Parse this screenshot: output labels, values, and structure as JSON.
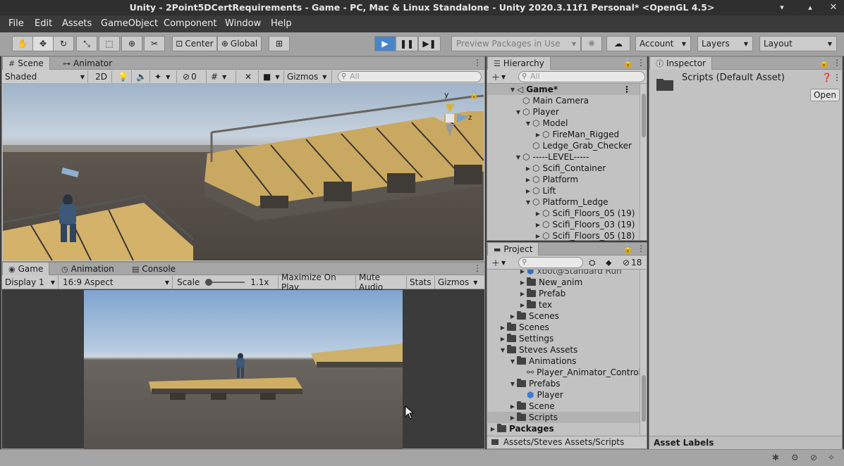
{
  "window": {
    "title": "Unity - 2Point5DCertRequirements - Game - PC, Mac & Linux Standalone - Unity 2020.3.11f1 Personal* <OpenGL 4.5>"
  },
  "menu": [
    "File",
    "Edit",
    "Assets",
    "GameObject",
    "Component",
    "Window",
    "Help"
  ],
  "toolbar": {
    "center_label": "Center",
    "global_label": "Global",
    "preview_packages_label": "Preview Packages in Use",
    "account_label": "Account",
    "layers_label": "Layers",
    "layout_label": "Layout"
  },
  "scene_panel": {
    "tabs": [
      "Scene",
      "Animator"
    ],
    "shading_mode": "Shaded",
    "mode_2d": "2D",
    "hidden_count": "0",
    "gizmos_label": "Gizmos",
    "search_placeholder": "All",
    "gizmo_axis_y": "y",
    "gizmo_axis_z": "z"
  },
  "game_panel": {
    "tabs": [
      "Game",
      "Animation",
      "Console"
    ],
    "display": "Display 1",
    "aspect": "16:9 Aspect",
    "scale_label": "Scale",
    "scale_value": "1.1x",
    "maximize_label": "Maximize On Play",
    "mute_label": "Mute Audio",
    "stats_label": "Stats",
    "gizmos_label": "Gizmos"
  },
  "hierarchy": {
    "tab": "Hierarchy",
    "search_placeholder": "All",
    "items": [
      {
        "label": "Game*",
        "depth": 0,
        "expanded": true,
        "bold": true
      },
      {
        "label": "Main Camera",
        "depth": 1
      },
      {
        "label": "Player",
        "depth": 1,
        "expanded": true
      },
      {
        "label": "Model",
        "depth": 2,
        "expanded": true
      },
      {
        "label": "FireMan_Rigged",
        "depth": 3,
        "collapsed": true
      },
      {
        "label": "Ledge_Grab_Checker",
        "depth": 2
      },
      {
        "label": "-----LEVEL-----",
        "depth": 1,
        "expanded": true
      },
      {
        "label": "Scifi_Container",
        "depth": 2,
        "collapsed": true
      },
      {
        "label": "Platform",
        "depth": 2,
        "collapsed": true
      },
      {
        "label": "Lift",
        "depth": 2,
        "collapsed": true
      },
      {
        "label": "Platform_Ledge",
        "depth": 2,
        "expanded": true
      },
      {
        "label": "Scifi_Floors_05 (19)",
        "depth": 3,
        "collapsed": true
      },
      {
        "label": "Scifi_Floors_03 (19)",
        "depth": 3,
        "collapsed": true
      },
      {
        "label": "Scifi_Floors_05 (18)",
        "depth": 3,
        "collapsed": true
      }
    ]
  },
  "project": {
    "tab": "Project",
    "hidden_count": "18",
    "items": [
      {
        "label": "xbot@Standard Run",
        "depth": 4,
        "kind": "model",
        "collapsed": true
      },
      {
        "label": "New_anim",
        "depth": 3,
        "kind": "folder",
        "collapsed": true
      },
      {
        "label": "Prefab",
        "depth": 3,
        "kind": "folder",
        "collapsed": true
      },
      {
        "label": "tex",
        "depth": 3,
        "kind": "folder",
        "collapsed": true
      },
      {
        "label": "Scenes",
        "depth": 2,
        "kind": "folder",
        "collapsed": true
      },
      {
        "label": "Scenes",
        "depth": 1,
        "kind": "folder",
        "collapsed": true
      },
      {
        "label": "Settings",
        "depth": 1,
        "kind": "folder",
        "collapsed": true
      },
      {
        "label": "Steves Assets",
        "depth": 1,
        "kind": "folder",
        "expanded": true
      },
      {
        "label": "Animations",
        "depth": 2,
        "kind": "folder",
        "expanded": true
      },
      {
        "label": "Player_Animator_Controll",
        "depth": 3,
        "kind": "animator"
      },
      {
        "label": "Prefabs",
        "depth": 2,
        "kind": "folder",
        "expanded": true
      },
      {
        "label": "Player",
        "depth": 3,
        "kind": "prefab"
      },
      {
        "label": "Scene",
        "depth": 2,
        "kind": "folder",
        "collapsed": true
      },
      {
        "label": "Scripts",
        "depth": 2,
        "kind": "folder",
        "collapsed": true,
        "selected": true
      },
      {
        "label": "Packages",
        "depth": 0,
        "kind": "folder",
        "collapsed": true,
        "bold": true
      }
    ],
    "path": "Assets/Steves Assets/Scripts"
  },
  "inspector": {
    "tab": "Inspector",
    "asset_title": "Scripts (Default Asset)",
    "open_label": "Open",
    "labels_header": "Asset Labels"
  }
}
